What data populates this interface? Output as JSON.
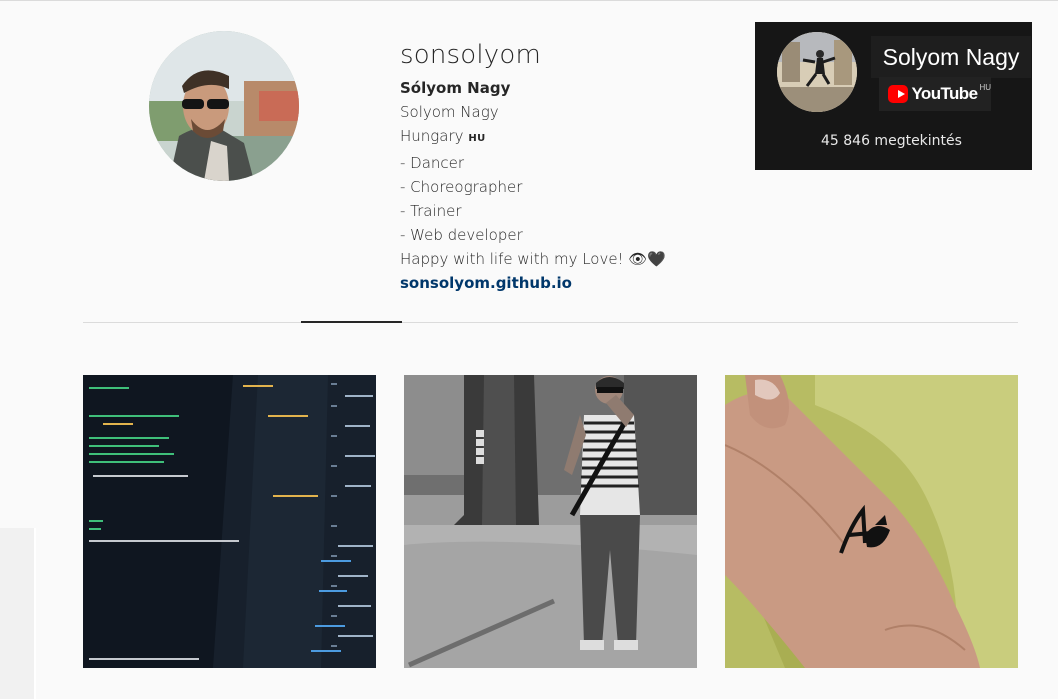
{
  "profile": {
    "username": "sonsolyom",
    "full_name": "Sólyom Nagy",
    "bio_lines": [
      "Solyom Nagy",
      "Hungary",
      "- Dancer",
      "- Choreographer",
      "- Trainer",
      "- Web developer",
      "Happy with life with my Love! 👁🖤"
    ],
    "country_flag": "HU",
    "website": "sonsolyom.github.io",
    "avatar_alt": "profile-photo"
  },
  "youtube_card": {
    "channel_name": "Solyom Nagy",
    "logo_text": "YouTube",
    "region": "HU",
    "views": "45 846 megtekintés"
  },
  "posts": [
    {
      "name": "code-editor-photo"
    },
    {
      "name": "forest-portrait-photo"
    },
    {
      "name": "hand-tattoo-photo"
    }
  ],
  "colors": {
    "background": "#fafafa",
    "link": "#00376b",
    "divider": "#dbdbdb",
    "youtube_red": "#ff0000",
    "card_bg": "#161616"
  }
}
